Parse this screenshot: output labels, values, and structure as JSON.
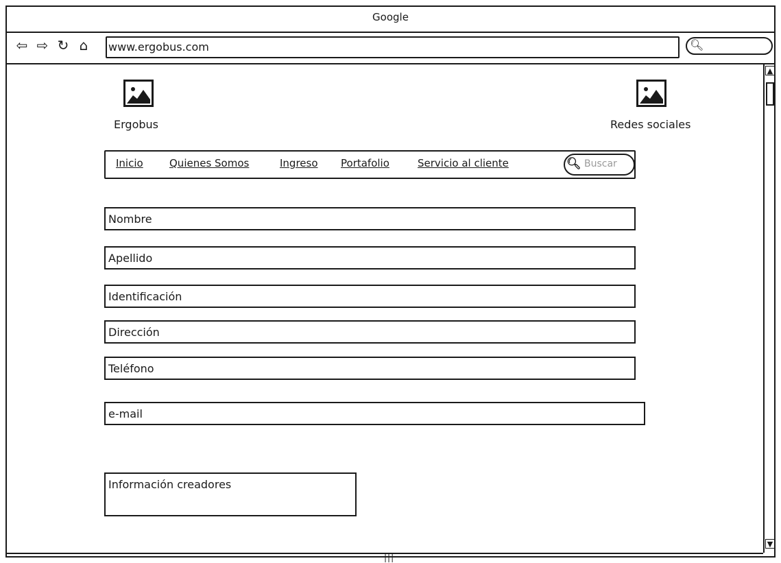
{
  "browser": {
    "title": "Google",
    "url": "www.ergobus.com",
    "nav_icons": [
      "back-arrow-icon",
      "forward-arrow-icon",
      "reload-icon",
      "home-icon"
    ],
    "search_icon": "search-icon"
  },
  "header": {
    "logo_label": "Ergobus",
    "social_label": "Redes sociales"
  },
  "menu": {
    "items": [
      "Inicio",
      "Quienes Somos",
      "Ingreso",
      "Portafolio",
      "Servicio al cliente"
    ],
    "search_placeholder": "Buscar"
  },
  "form": {
    "fields": [
      "Nombre",
      "Apellido",
      "Identificación",
      "Dirección",
      "Teléfono",
      "e-mail"
    ]
  },
  "footer": {
    "info_label": "Información creadores"
  }
}
